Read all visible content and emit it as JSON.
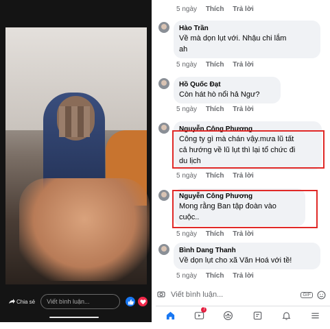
{
  "video": {
    "share_label": "Chia sẻ",
    "comment_placeholder": "Viết bình luận..."
  },
  "comments": [
    {
      "meta": {
        "time": "5 ngày",
        "like": "Thích",
        "reply": "Trả lời"
      }
    },
    {
      "author": "Hào Trần",
      "lines": [
        "Về mà dọn lụt với.  Nhậu chi lắm",
        "ah"
      ],
      "meta": {
        "time": "5 ngày",
        "like": "Thích",
        "reply": "Trả lời"
      }
    },
    {
      "author": "Hồ Quốc Đạt",
      "lines": [
        "Còn hát hò nổi hả Ngư?"
      ],
      "meta": {
        "time": "5 ngày",
        "like": "Thích",
        "reply": "Trả lời"
      }
    },
    {
      "author": "Nguyễn Công Phương",
      "lines": [
        "Công ty gì mà chán vậy.mưa lũ tất",
        "cả hướng về lũ lụt thì lại tổ chức đi",
        "du lịch"
      ],
      "meta": {
        "time": "5 ngày",
        "like": "Thích",
        "reply": "Trả lời"
      }
    },
    {
      "author": "Nguyễn Công Phương",
      "lines": [
        "Mong rằng Ban tập đoàn vào",
        "cuộc.."
      ],
      "meta": {
        "time": "5 ngày",
        "like": "Thích",
        "reply": "Trả lời"
      }
    },
    {
      "author": "Bình Dang Thanh",
      "lines": [
        "Về dọn lụt cho xã Văn Hoá với tề!"
      ],
      "meta": {
        "time": "5 ngày",
        "like": "Thích",
        "reply": "Trả lời"
      }
    }
  ],
  "composer": {
    "placeholder": "Viết bình luận...",
    "gif_label": "GIF"
  },
  "tabbar": {
    "video_badge": "7"
  },
  "colors": {
    "highlight": "#e02826",
    "bubble": "#f0f2f5",
    "accent": "#1877f2"
  }
}
